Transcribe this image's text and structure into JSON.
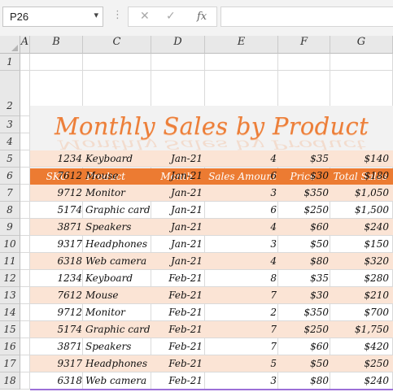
{
  "name_box": "P26",
  "formula_bar": {
    "cancel_icon": "✕",
    "enter_icon": "✓",
    "fx_label": "fx",
    "value": ""
  },
  "columns": [
    "A",
    "B",
    "C",
    "D",
    "E",
    "F",
    "G"
  ],
  "rows": [
    "1",
    "2",
    "3",
    "4",
    "5",
    "6",
    "7",
    "8",
    "9",
    "10",
    "11",
    "12",
    "13",
    "14",
    "15",
    "16",
    "17",
    "18"
  ],
  "sheet": {
    "title": "Monthly Sales by Product",
    "headers": {
      "sku": "SKU",
      "product": "Product",
      "month": "Month",
      "sales_amount": "Sales Amount",
      "price": "Price",
      "total_sales": "Total Sales"
    },
    "records": [
      {
        "sku": "1234",
        "product": "Keyboard",
        "month": "Jan-21",
        "amount": "4",
        "price": "$35",
        "total": "$140"
      },
      {
        "sku": "7612",
        "product": "Mouse",
        "month": "Jan-21",
        "amount": "6",
        "price": "$30",
        "total": "$180"
      },
      {
        "sku": "9712",
        "product": "Monitor",
        "month": "Jan-21",
        "amount": "3",
        "price": "$350",
        "total": "$1,050"
      },
      {
        "sku": "5174",
        "product": "Graphic card",
        "month": "Jan-21",
        "amount": "6",
        "price": "$250",
        "total": "$1,500"
      },
      {
        "sku": "3871",
        "product": "Speakers",
        "month": "Jan-21",
        "amount": "4",
        "price": "$60",
        "total": "$240"
      },
      {
        "sku": "9317",
        "product": "Headphones",
        "month": "Jan-21",
        "amount": "3",
        "price": "$50",
        "total": "$150"
      },
      {
        "sku": "6318",
        "product": "Web camera",
        "month": "Jan-21",
        "amount": "4",
        "price": "$80",
        "total": "$320"
      },
      {
        "sku": "1234",
        "product": "Keyboard",
        "month": "Feb-21",
        "amount": "8",
        "price": "$35",
        "total": "$280"
      },
      {
        "sku": "7612",
        "product": "Mouse",
        "month": "Feb-21",
        "amount": "7",
        "price": "$30",
        "total": "$210"
      },
      {
        "sku": "9712",
        "product": "Monitor",
        "month": "Feb-21",
        "amount": "2",
        "price": "$350",
        "total": "$700"
      },
      {
        "sku": "5174",
        "product": "Graphic card",
        "month": "Feb-21",
        "amount": "7",
        "price": "$250",
        "total": "$1,750"
      },
      {
        "sku": "3871",
        "product": "Speakers",
        "month": "Feb-21",
        "amount": "7",
        "price": "$60",
        "total": "$420"
      },
      {
        "sku": "9317",
        "product": "Headphones",
        "month": "Feb-21",
        "amount": "5",
        "price": "$50",
        "total": "$250"
      },
      {
        "sku": "6318",
        "product": "Web camera",
        "month": "Feb-21",
        "amount": "3",
        "price": "$80",
        "total": "$240"
      }
    ]
  },
  "colors": {
    "accent": "#ec7b32",
    "band": "#fbe4d5",
    "title": "#ec7f3a"
  }
}
